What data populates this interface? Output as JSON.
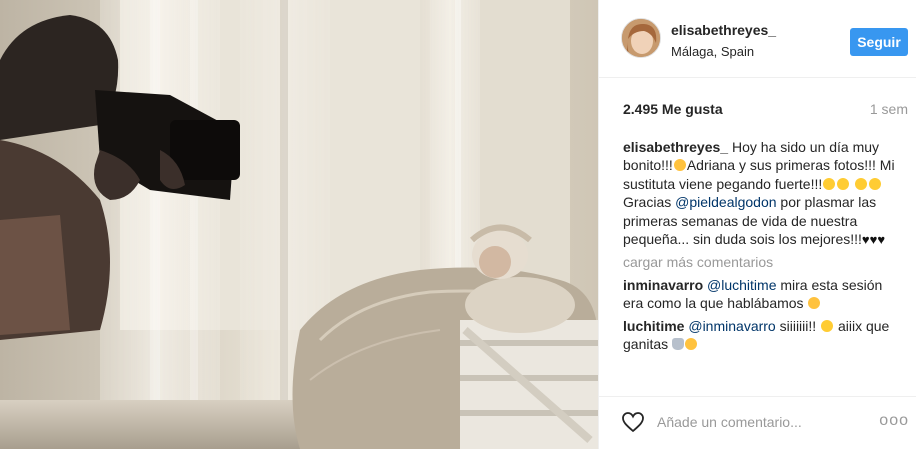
{
  "post": {
    "image_alt": "",
    "username": "elisabethreyes_",
    "location": "Málaga, Spain",
    "follow_label": "Seguir",
    "likes": "2.495 Me gusta",
    "time_ago": "1 sem",
    "caption": {
      "user": "elisabethreyes_",
      "part1": "Hoy ha sido un día muy bonito!!!",
      "part2": "Adriana y sus primeras fotos!!! Mi sustituta viene pegando fuerte!!!",
      "part3": " Gracias ",
      "mention": "@pieldealgodon",
      "part4": " por plasmar las primeras semanas de vida de nuestra pequeña... sin duda sois los mejores!!!"
    },
    "load_more": "cargar más comentarios",
    "comments": [
      {
        "user": "inminavarro",
        "mention": "@luchitime",
        "text": " mira esta sesión era como la que hablábamos "
      },
      {
        "user": "luchitime",
        "mention": "@inminavarro",
        "text": " siiiiiii!! ",
        "text2": " aiiix que ganitas "
      }
    ],
    "add_comment_placeholder": "Añade un comentario...",
    "more_label": "ooo",
    "icons": {
      "like": "heart-outline-icon",
      "more": "more-options-icon",
      "emoji": "smiley-emoji-icon"
    },
    "colors": {
      "follow_bg": "#3897f0",
      "mention": "#003569",
      "muted": "#999999"
    }
  }
}
